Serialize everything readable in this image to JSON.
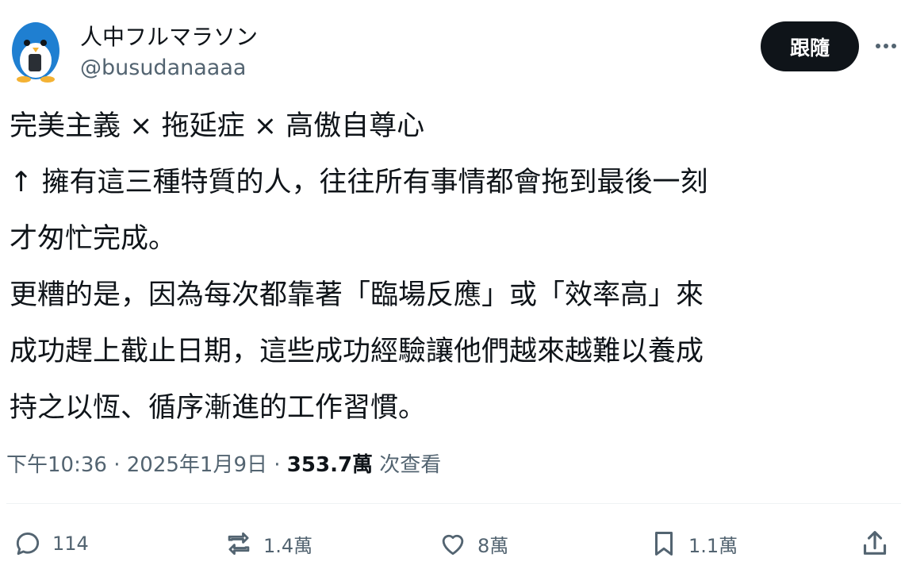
{
  "user": {
    "display_name": "人中フルマラソン",
    "handle": "@busudanaaaa"
  },
  "follow_button": "跟隨",
  "tweet_lines": [
    "完美主義 × 拖延症 × 高傲自尊心",
    "↑ 擁有這三種特質的人，往往所有事情都會拖到最後一刻",
    "才匆忙完成。",
    "更糟的是，因為每次都靠著「臨場反應」或「效率高」來",
    "成功趕上截止日期，這些成功經驗讓他們越來越難以養成",
    "持之以恆、循序漸進的工作習慣。"
  ],
  "meta": {
    "time": "下午10:36",
    "sep1": " · ",
    "date": "2025年1月9日",
    "sep2": " · ",
    "views": "353.7萬",
    "views_label": " 次查看"
  },
  "actions": {
    "replies": "114",
    "retweets": "1.4萬",
    "likes": "8萬",
    "bookmarks": "1.1萬"
  },
  "colors": {
    "text": "#0f1419",
    "secondary": "#536471",
    "avatar_blue": "#1f7fd1",
    "avatar_yellow": "#f4b233"
  }
}
